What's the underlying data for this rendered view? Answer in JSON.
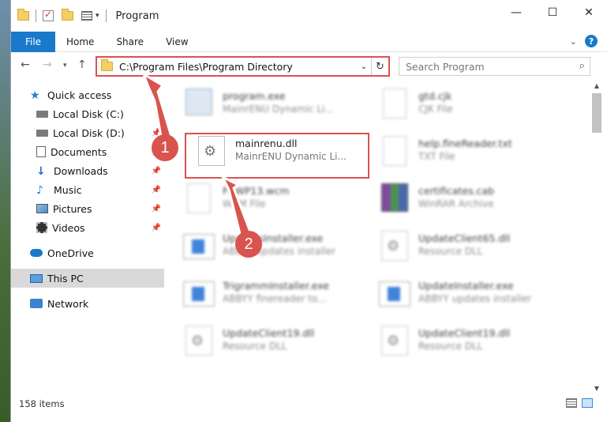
{
  "window": {
    "title": "Program",
    "controls": {
      "minimize": "—",
      "maximize": "☐",
      "close": "✕"
    }
  },
  "ribbon": {
    "file_tab": "File",
    "tabs": [
      "Home",
      "Share",
      "View"
    ]
  },
  "address": {
    "path": "C:\\Program Files\\Program Directory",
    "search_placeholder": "Search Program"
  },
  "sidebar": {
    "items": [
      {
        "label": "Quick access",
        "icon": "star-icon"
      },
      {
        "label": "Local Disk (C:)",
        "icon": "disk-icon",
        "pinned": true
      },
      {
        "label": "Local Disk (D:)",
        "icon": "disk-icon",
        "pinned": true
      },
      {
        "label": "Documents",
        "icon": "documents-icon",
        "pinned": true
      },
      {
        "label": "Downloads",
        "icon": "download-icon",
        "pinned": true
      },
      {
        "label": "Music",
        "icon": "music-icon",
        "pinned": true
      },
      {
        "label": "Pictures",
        "icon": "pictures-icon",
        "pinned": true
      },
      {
        "label": "Videos",
        "icon": "videos-icon",
        "pinned": true
      },
      {
        "label": "OneDrive",
        "icon": "cloud-icon"
      },
      {
        "label": "This PC",
        "icon": "pc-icon",
        "selected": true
      },
      {
        "label": "Network",
        "icon": "network-icon"
      }
    ]
  },
  "files": {
    "items": [
      {
        "name": "program.exe",
        "desc": "MainrENU Dynamic Li...",
        "thumb": "exe",
        "blurred": true
      },
      {
        "name": "gtd.cjk",
        "desc": "CJK File",
        "thumb": "doc",
        "blurred": true
      },
      {
        "name": "mainrenu.dll",
        "desc": "MainrENU Dynamic Li...",
        "thumb": "gear",
        "blurred": false
      },
      {
        "name": "help.fineReader.txt",
        "desc": "TXT File",
        "thumb": "doc",
        "blurred": true
      },
      {
        "name": "FRWP13.wcm",
        "desc": "WCM File",
        "thumb": "doc",
        "blurred": true
      },
      {
        "name": "certificates.cab",
        "desc": "WinRAR Archive",
        "thumb": "rar",
        "blurred": true
      },
      {
        "name": "UpdatesInstaller.exe",
        "desc": "ABBYY updates installer",
        "thumb": "inst",
        "blurred": true
      },
      {
        "name": "UpdateClient65.dll",
        "desc": "Resource DLL",
        "thumb": "gear",
        "blurred": true
      },
      {
        "name": "TrigrammInstaller.exe",
        "desc": "ABBYY finereader to...",
        "thumb": "inst",
        "blurred": true
      },
      {
        "name": "UpdateInstaller.exe",
        "desc": "ABBYY updates installer",
        "thumb": "inst",
        "blurred": true
      },
      {
        "name": "UpdateClient19.dll",
        "desc": "Resource DLL",
        "thumb": "gear",
        "blurred": true
      },
      {
        "name": "UpdateClient19.dll",
        "desc": "Resource DLL",
        "thumb": "gear",
        "blurred": true
      }
    ]
  },
  "status": {
    "count": "158 items"
  },
  "annotations": {
    "step1": "1",
    "step2": "2",
    "color": "#d9534f"
  }
}
